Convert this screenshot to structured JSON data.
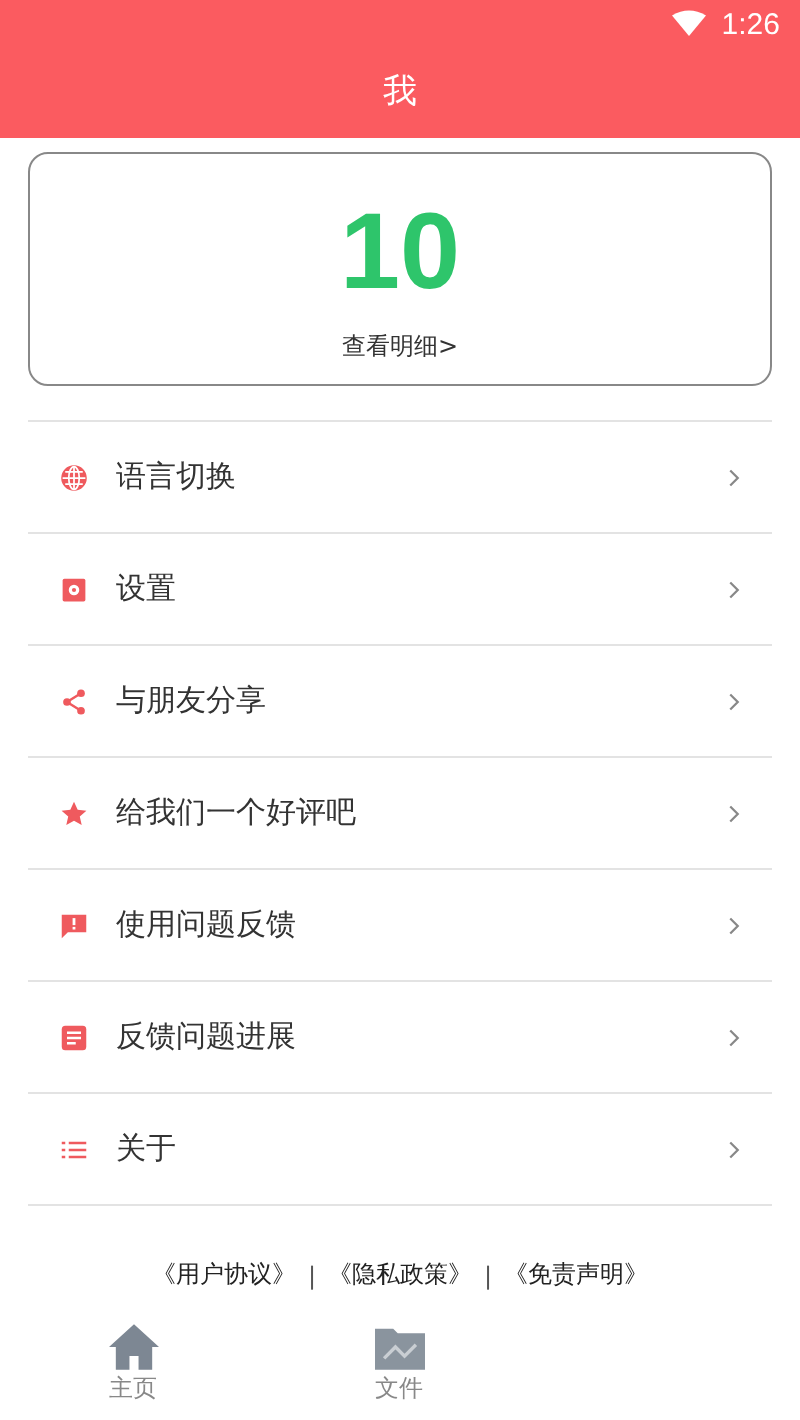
{
  "status_bar": {
    "time": "1:26"
  },
  "header": {
    "title": "我"
  },
  "points_card": {
    "value": "10",
    "link": "查看明细>"
  },
  "menu": [
    {
      "kind": "globe",
      "label": "语言切换"
    },
    {
      "kind": "gear",
      "label": "设置"
    },
    {
      "kind": "share",
      "label": "与朋友分享"
    },
    {
      "kind": "star",
      "label": "给我们一个好评吧"
    },
    {
      "kind": "feedback",
      "label": "使用问题反馈"
    },
    {
      "kind": "note",
      "label": "反馈问题进展"
    },
    {
      "kind": "list",
      "label": "关于"
    }
  ],
  "footer_links": [
    "《用户协议》",
    "《隐私政策》",
    "《免责声明》"
  ],
  "footer_separators": [
    "|",
    "|"
  ],
  "bottom_nav": [
    {
      "kind": "home",
      "label": "主页"
    },
    {
      "kind": "folder",
      "label": "文件"
    }
  ]
}
